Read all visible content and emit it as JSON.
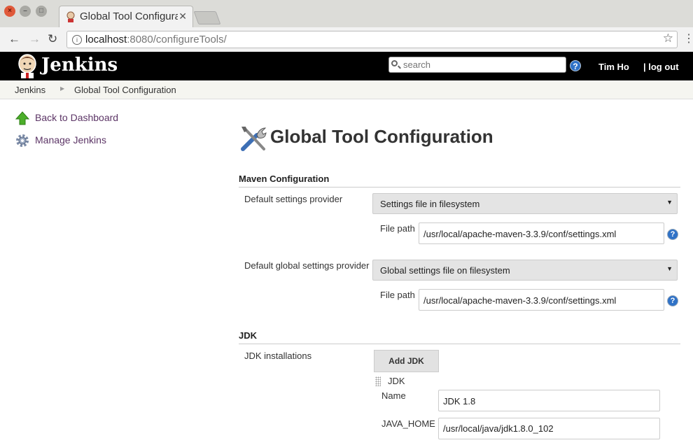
{
  "browser": {
    "tab_title": "Global Tool Configuration",
    "url_host": "localhost",
    "url_path": ":8080/configureTools/"
  },
  "header": {
    "brand": "Jenkins",
    "search_placeholder": "search",
    "user": "Tim Ho",
    "logout": "| log out"
  },
  "breadcrumb": [
    "Jenkins",
    "Global Tool Configuration"
  ],
  "sidebar": {
    "items": [
      {
        "label": "Back to Dashboard",
        "icon": "up-arrow-icon"
      },
      {
        "label": "Manage Jenkins",
        "icon": "gear-icon"
      }
    ]
  },
  "main": {
    "title": "Global Tool Configuration",
    "maven": {
      "heading": "Maven Configuration",
      "default_settings_label": "Default settings provider",
      "default_settings_value": "Settings file in filesystem",
      "file_path_label": "File path",
      "file_path_value": "/usr/local/apache-maven-3.3.9/conf/settings.xml",
      "global_settings_label": "Default global settings provider",
      "global_settings_value": "Global settings file on filesystem",
      "global_file_path_label": "File path",
      "global_file_path_value": "/usr/local/apache-maven-3.3.9/conf/settings.xml"
    },
    "jdk": {
      "heading": "JDK",
      "installations_label": "JDK installations",
      "add_button": "Add JDK",
      "item_heading": "JDK",
      "name_label": "Name",
      "name_value": "JDK 1.8",
      "java_home_label": "JAVA_HOME",
      "java_home_value": "/usr/local/java/jdk1.8.0_102"
    }
  },
  "colors": {
    "header_bg": "#000000",
    "link": "#5c3566",
    "help_blue": "#2f72c7"
  }
}
